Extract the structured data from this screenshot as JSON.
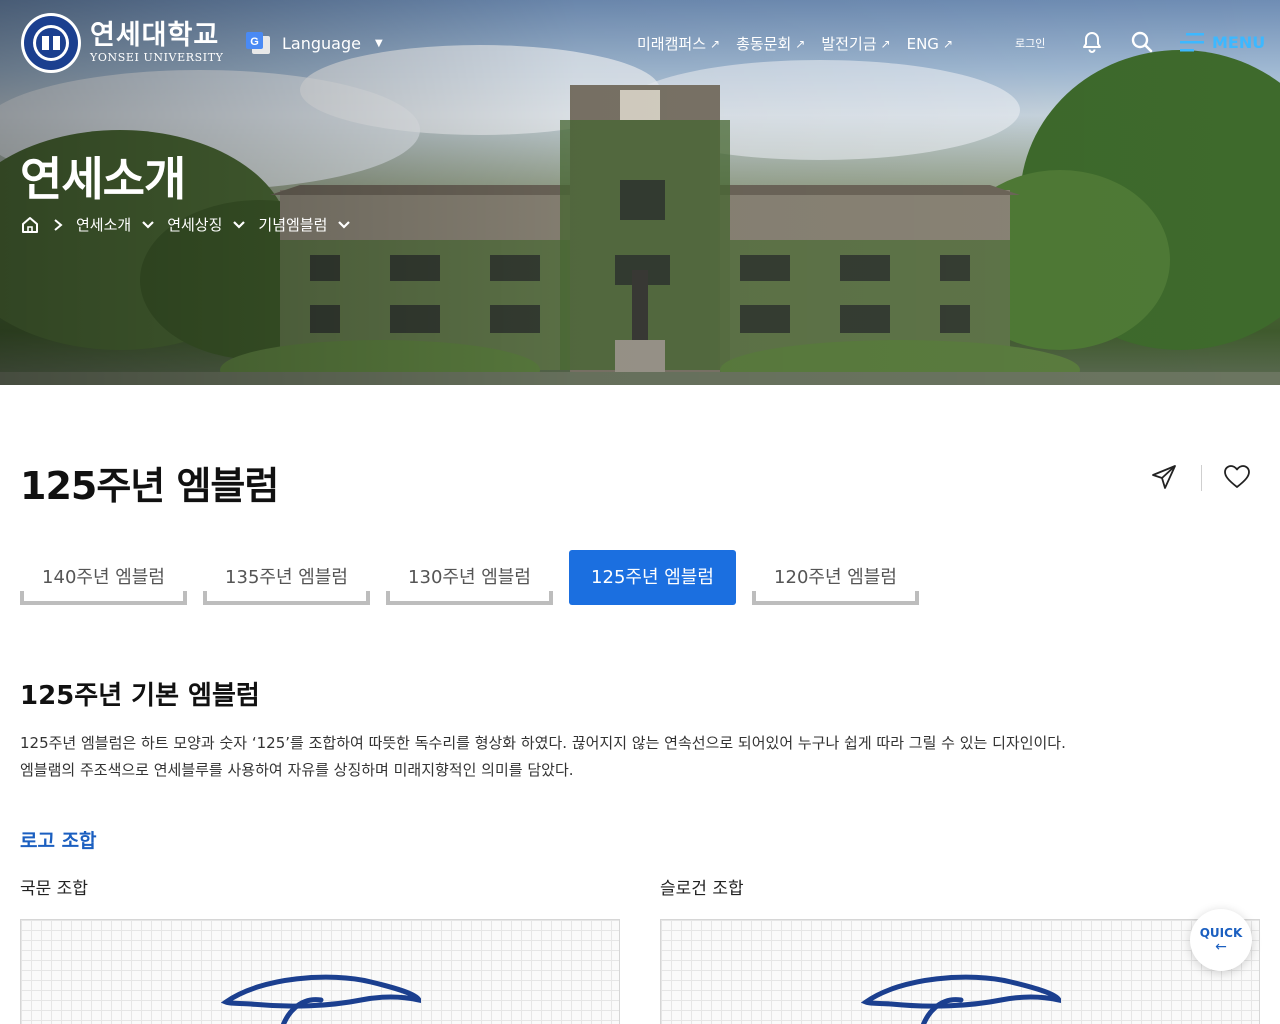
{
  "header": {
    "logo_ko": "연세대학교",
    "logo_en": "YONSEI UNIVERSITY",
    "language_label": "Language",
    "nav": [
      {
        "label": "미래캠퍼스"
      },
      {
        "label": "총동문회"
      },
      {
        "label": "발전기금"
      },
      {
        "label": "ENG"
      }
    ],
    "login_label": "로그인",
    "menu_label": "MENU"
  },
  "hero": {
    "title": "연세소개",
    "breadcrumb": [
      "연세소개",
      "연세상징",
      "기념엠블럼"
    ]
  },
  "page": {
    "title": "125주년 엠블럼",
    "tabs": [
      {
        "label": "140주년 엠블럼",
        "active": false
      },
      {
        "label": "135주년 엠블럼",
        "active": false
      },
      {
        "label": "130주년 엠블럼",
        "active": false
      },
      {
        "label": "125주년 엠블럼",
        "active": true
      },
      {
        "label": "120주년 엠블럼",
        "active": false
      }
    ],
    "section_title": "125주년 기본 엠블럼",
    "description_line1": "125주년 엠블럼은 하트 모양과 숫자 ‘125’를 조합하여 따뜻한 독수리를 형상화 하였다. 끊어지지 않는 연속선으로 되어있어 누구나 쉽게 따라 그릴 수 있는 디자인이다.",
    "description_line2": "엠블램의 주조색으로 연세블루를 사용하여 자유를 상징하며 미래지향적인 의미를 담았다.",
    "sub_title": "로고 조합",
    "col_left_label": "국문 조합",
    "col_right_label": "슬로건 조합"
  },
  "quick": {
    "label": "QUICK",
    "arrow": "←"
  },
  "colors": {
    "yonsei_blue": "#1b3f8f",
    "tab_active": "#1b6fe0",
    "accent_text": "#1b5fc0",
    "menu_accent": "#3db8ff"
  },
  "icons": [
    "google-translate-icon",
    "external-link-icon",
    "bell-icon",
    "search-icon",
    "menu-icon",
    "home-icon",
    "chevron-right-icon",
    "chevron-down-icon",
    "share-icon",
    "heart-icon"
  ]
}
